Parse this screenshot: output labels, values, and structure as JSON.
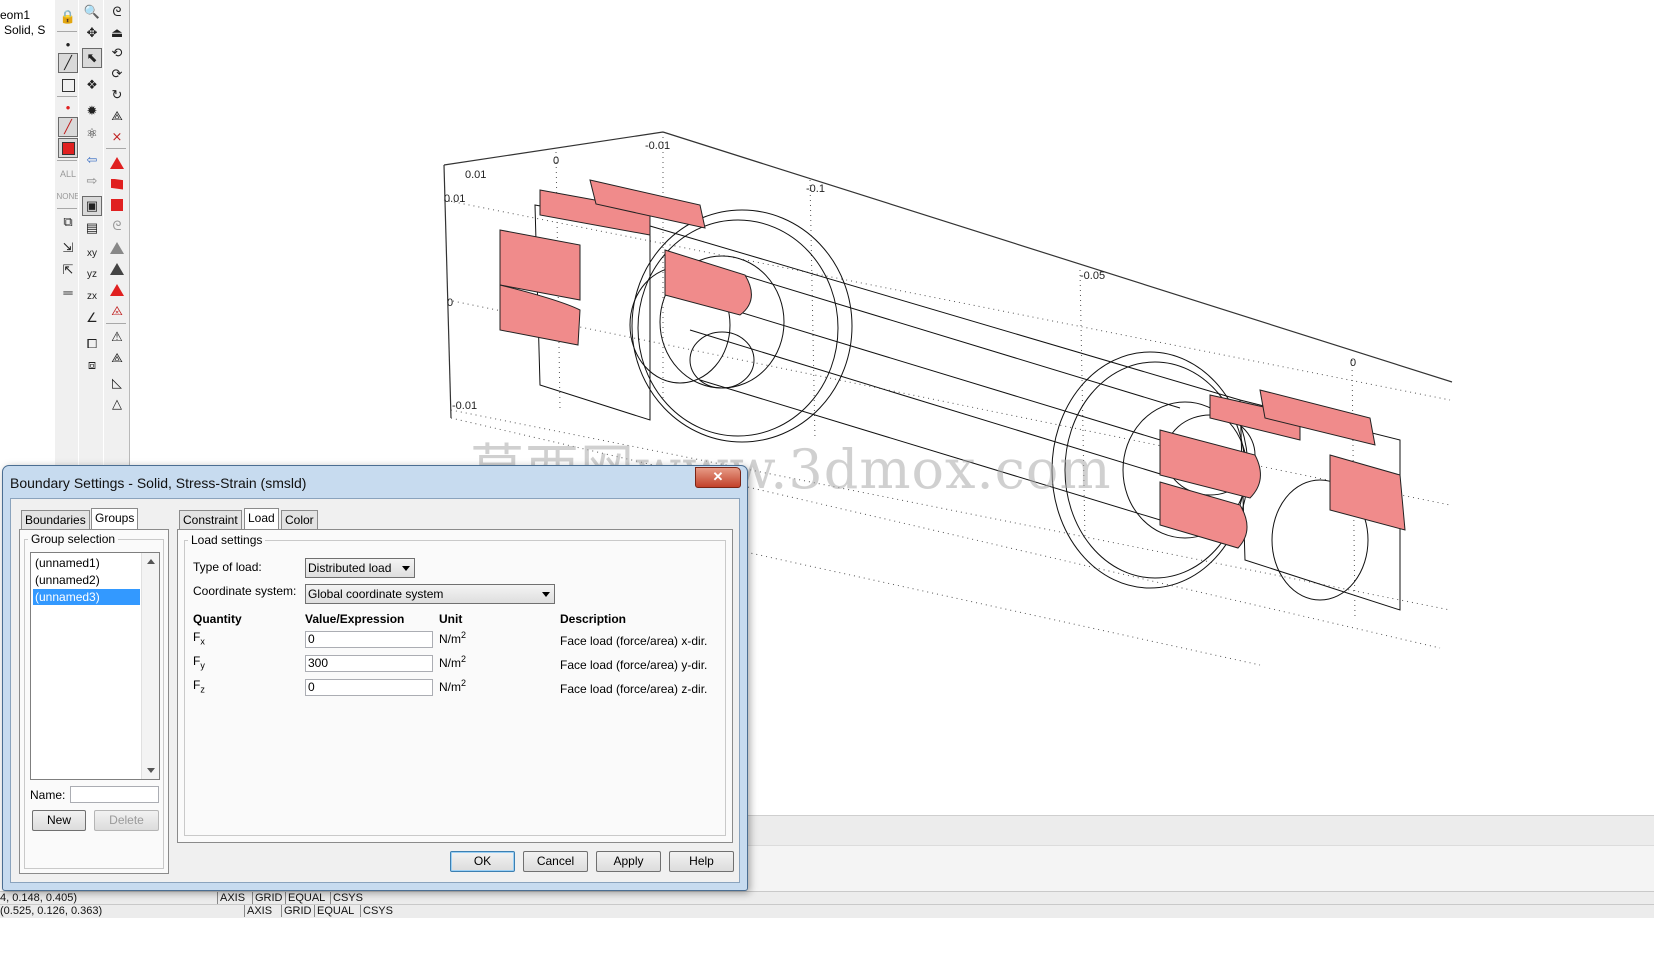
{
  "model_tree": {
    "line1": "eom1",
    "line2": "Solid, S"
  },
  "watermark": "莫西网www.3dmox.com",
  "axes": {
    "ticks": [
      "0.01",
      "0",
      "-0.01",
      "0.01",
      "-0.1",
      "0",
      "-0.05",
      "0",
      "-0.01"
    ]
  },
  "dialog": {
    "title": "Boundary Settings - Solid, Stress-Strain (smsld)",
    "close": "✕",
    "left_tabs": [
      "Boundaries",
      "Groups"
    ],
    "right_tabs": [
      "Constraint",
      "Load",
      "Color"
    ],
    "group_selection": {
      "title": "Group selection",
      "items": [
        "(unnamed1)",
        "(unnamed2)",
        "(unnamed3)"
      ],
      "selected": "(unnamed3)",
      "name_label": "Name:",
      "name_value": "",
      "new_button": "New",
      "delete_button": "Delete"
    },
    "load_settings": {
      "title": "Load settings",
      "type_label": "Type of load:",
      "type_value": "Distributed load",
      "coord_label": "Coordinate system:",
      "coord_value": "Global coordinate system",
      "headers": {
        "quantity": "Quantity",
        "value": "Value/Expression",
        "unit": "Unit",
        "description": "Description"
      },
      "rows": [
        {
          "q": "F",
          "sub": "x",
          "value": "0",
          "unit": "N/m",
          "exp": "2",
          "desc": "Face load (force/area) x-dir."
        },
        {
          "q": "F",
          "sub": "y",
          "value": "300",
          "unit": "N/m",
          "exp": "2",
          "desc": "Face load (force/area) y-dir."
        },
        {
          "q": "F",
          "sub": "z",
          "value": "0",
          "unit": "N/m",
          "exp": "2",
          "desc": "Face load (force/area) z-dir."
        }
      ]
    },
    "buttons": {
      "ok": "OK",
      "cancel": "Cancel",
      "apply": "Apply",
      "help": "Help"
    }
  },
  "status": {
    "line1_coords": "4, 0.148, 0.405)",
    "line2_coords": "(0.525, 0.126, 0.363)",
    "cells": [
      "AXIS",
      "GRID",
      "EQUAL",
      "CSYS"
    ]
  },
  "colors": {
    "selected_face": "#f08b8b",
    "accent_blue": "#3399ff",
    "dialog_frame": "#c7dbef"
  }
}
